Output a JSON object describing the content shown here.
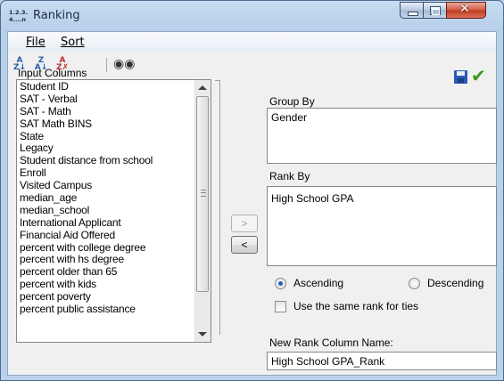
{
  "window": {
    "title": "Ranking",
    "app_icon_text": "1.2.3.\n4....n"
  },
  "menu": {
    "file": "File",
    "sort": "Sort"
  },
  "toolbar": {
    "sort_az_icon": "sort-ascending-icon",
    "sort_za_icon": "sort-descending-icon",
    "clear_sort_icon": "clear-sort-icon",
    "find_icon": "binoculars-icon",
    "save_icon": "save-icon",
    "ok_icon": "checkmark-icon"
  },
  "input_columns": {
    "label": "Input Columns",
    "items": [
      "Student ID",
      "SAT - Verbal",
      "SAT - Math",
      "SAT Math BINS",
      "State",
      "Legacy",
      "Student distance from school",
      "Enroll",
      "Visited Campus",
      "median_age",
      "median_school",
      "International Applicant",
      "Financial Aid Offered",
      "percent with college degree",
      "percent with hs degree",
      "percent older than 65",
      "percent with kids",
      "percent poverty",
      "percent public assistance"
    ]
  },
  "move": {
    "right": ">",
    "left": "<"
  },
  "group_by": {
    "label": "Group By",
    "value": "Gender"
  },
  "rank_by": {
    "label": "Rank By",
    "value": "High School GPA"
  },
  "order": {
    "ascending": "Ascending",
    "descending": "Descending",
    "selected": "Ascending"
  },
  "same_rank": {
    "label": "Use the same rank for ties",
    "checked": false
  },
  "new_rank": {
    "label": "New Rank Column Name:",
    "value": "High School GPA_Rank"
  },
  "colors": {
    "accent": "#1f5fbf",
    "close_button": "#c8452b",
    "check_green": "#3a9a1e"
  }
}
